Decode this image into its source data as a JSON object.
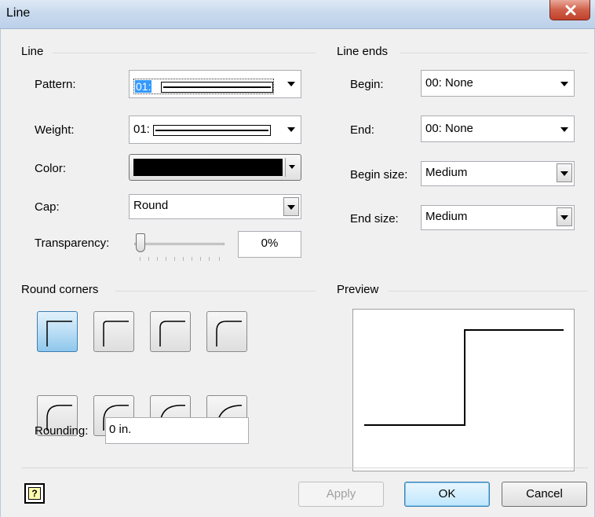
{
  "window": {
    "title": "Line"
  },
  "line_group": {
    "label": "Line",
    "pattern": {
      "label": "Pattern:",
      "value": "01:"
    },
    "weight": {
      "label": "Weight:",
      "value": "01:"
    },
    "color": {
      "label": "Color:",
      "value": "#000000"
    },
    "cap": {
      "label": "Cap:",
      "value": "Round"
    },
    "transparency": {
      "label": "Transparency:",
      "value": "0%",
      "level": 0
    }
  },
  "line_ends_group": {
    "label": "Line ends",
    "begin": {
      "label": "Begin:",
      "value": "00: None"
    },
    "end": {
      "label": "End:",
      "value": "00: None"
    },
    "begin_size": {
      "label": "Begin size:",
      "value": "Medium"
    },
    "end_size": {
      "label": "End size:",
      "value": "Medium"
    }
  },
  "round_corners_group": {
    "label": "Round corners",
    "selected_index": 0,
    "rounding": {
      "label": "Rounding:",
      "value": "0 in."
    }
  },
  "preview_group": {
    "label": "Preview"
  },
  "buttons": {
    "apply": "Apply",
    "ok": "OK",
    "cancel": "Cancel",
    "help": "?"
  }
}
